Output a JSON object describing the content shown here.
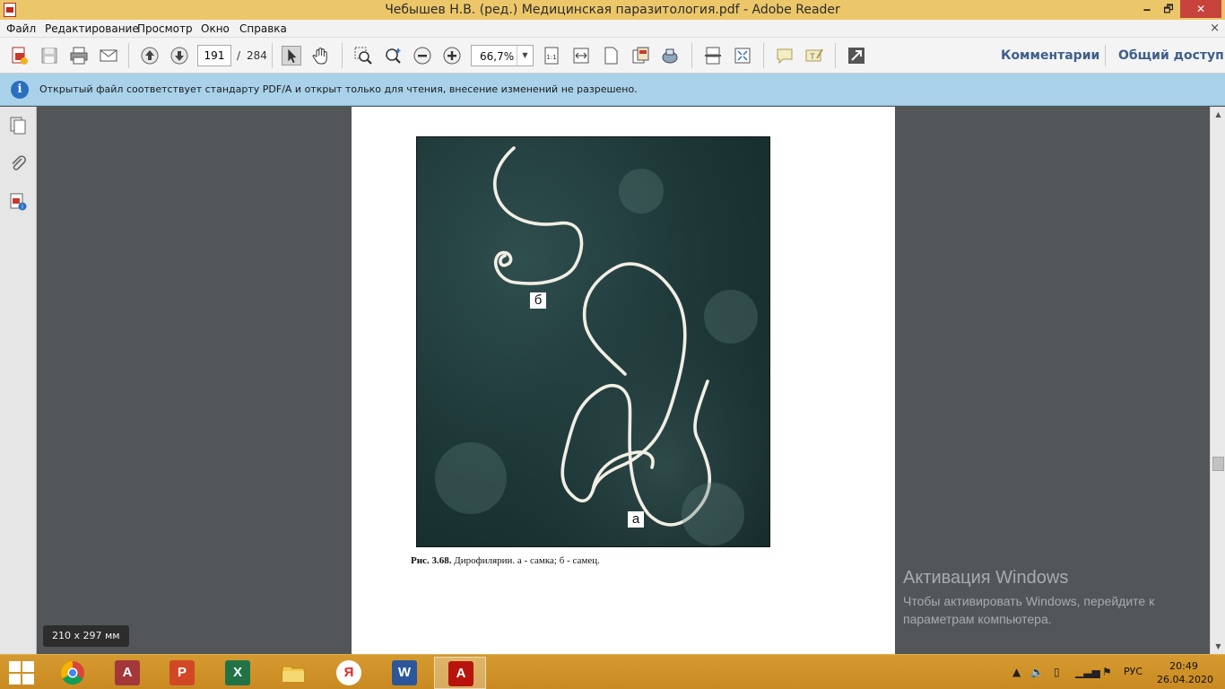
{
  "window": {
    "title": "Чебышев Н.В. (ред.) Медицинская паразитология.pdf - Adobe Reader",
    "minimize_glyph": "🗕",
    "maximize_glyph": "🗗",
    "close_glyph": "✕"
  },
  "menu": {
    "items": [
      "Файл",
      "Редактирование",
      "Просмотр",
      "Окно",
      "Справка"
    ],
    "close_glyph": "×"
  },
  "toolbar": {
    "current_page": "191",
    "page_separator": "/",
    "total_pages": "284",
    "zoom": "66,7%",
    "comments_label": "Комментарии",
    "share_label": "Общий доступ"
  },
  "infobar": {
    "icon_letter": "i",
    "message": "Открытый файл соответствует стандарту PDF/A и открыт только для чтения, внесение изменений не разрешено."
  },
  "document": {
    "figure_labels": {
      "a": "а",
      "b": "б"
    },
    "caption_bold": "Рис. 3.68.",
    "caption_text": " Дирофилярии. а - самка; б - самец."
  },
  "page_size_tooltip": "210 x 297 мм",
  "activation": {
    "title": "Активация Windows",
    "text": "Чтобы активировать Windows, перейдите к параметрам компьютера."
  },
  "taskbar": {
    "apps": [
      {
        "name": "chrome",
        "letter": "",
        "color": "#db4437"
      },
      {
        "name": "access",
        "letter": "A",
        "color": "#a4373a"
      },
      {
        "name": "powerpoint",
        "letter": "P",
        "color": "#d24726"
      },
      {
        "name": "excel",
        "letter": "X",
        "color": "#217346"
      },
      {
        "name": "file-explorer",
        "letter": "",
        "color": "#e8b93a"
      },
      {
        "name": "yandex-browser",
        "letter": "Я",
        "color": "#e52620"
      },
      {
        "name": "word",
        "letter": "W",
        "color": "#2b579a"
      },
      {
        "name": "adobe-reader",
        "letter": "A",
        "color": "#b7140e"
      }
    ],
    "language": "РУС",
    "time": "20:49",
    "date": "26.04.2020"
  }
}
